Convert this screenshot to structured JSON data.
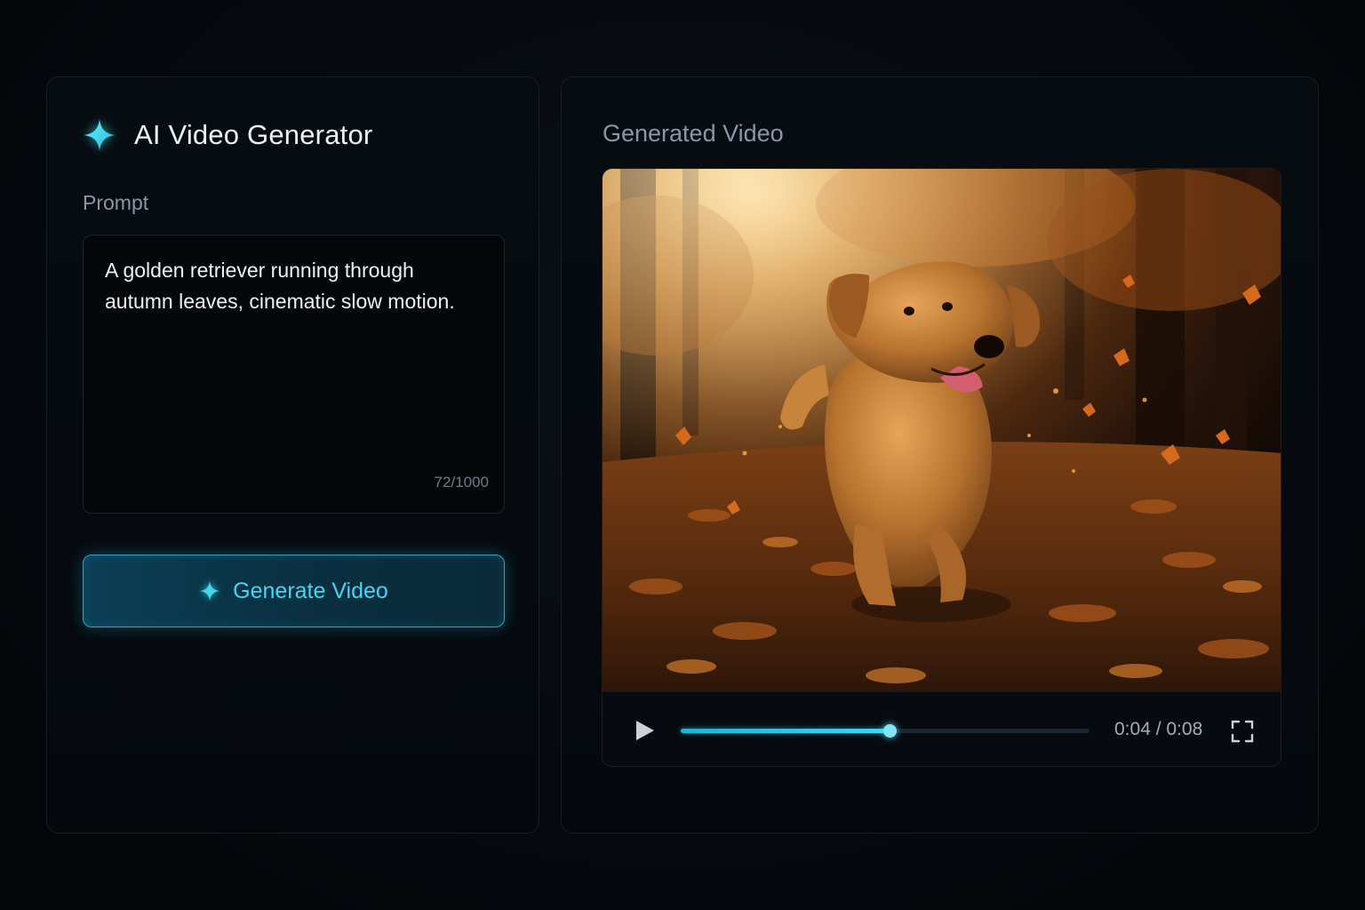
{
  "app": {
    "title": "AI Video Generator",
    "logo_icon": "sparkle-icon",
    "accent_color": "#38dcf0"
  },
  "prompt": {
    "label": "Prompt",
    "value": "A golden retriever running through\nautumn leaves, cinematic slow motion.",
    "char_count": "72/1000"
  },
  "generate_button": {
    "label": "Generate Video",
    "icon": "sparkle-icon"
  },
  "video": {
    "section_title": "Generated Video",
    "progress_fraction": 0.51,
    "time": "0:04 / 0:08",
    "play_icon": "play-icon",
    "fullscreen_icon": "fullscreen-icon"
  }
}
